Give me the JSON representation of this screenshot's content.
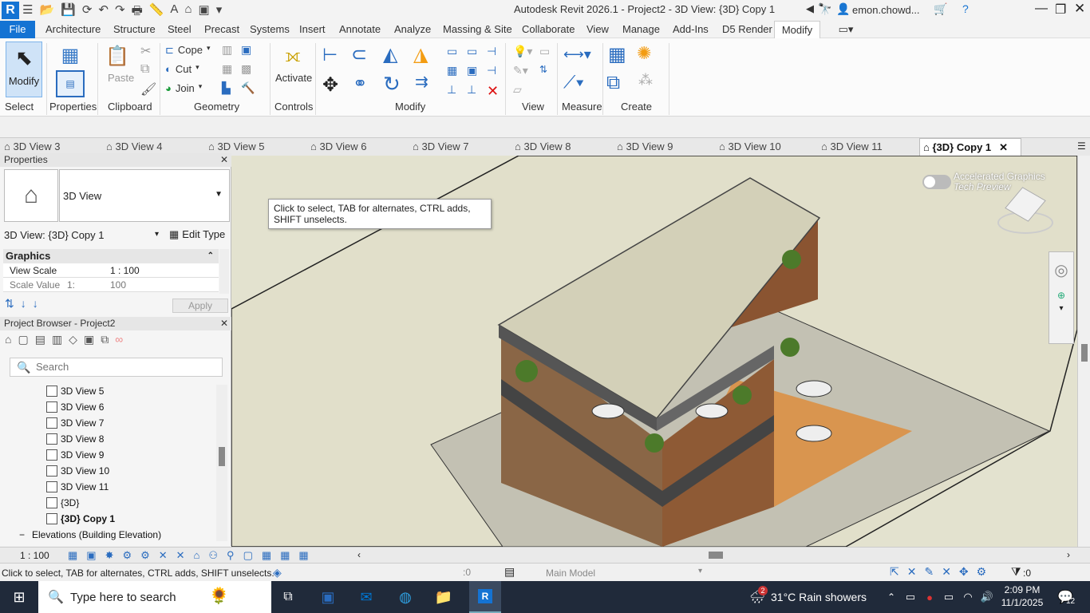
{
  "titlebar": {
    "title": "Autodesk Revit 2026.1 - Project2 - 3D View: {3D} Copy 1",
    "user": "emon.chowd..."
  },
  "ribbon_tabs": [
    "File",
    "Architecture",
    "Structure",
    "Steel",
    "Precast",
    "Systems",
    "Insert",
    "Annotate",
    "Analyze",
    "Massing & Site",
    "Collaborate",
    "View",
    "Manage",
    "Add-Ins",
    "D5 Render",
    "Modify"
  ],
  "ribbon": {
    "modify_label": "Modify",
    "select_label": "Select",
    "properties_label": "Properties",
    "clipboard_label": "Clipboard",
    "paste_label": "Paste",
    "cope_label": "Cope",
    "cut_label": "Cut",
    "join_label": "Join",
    "geometry_label": "Geometry",
    "activate_label": "Activate",
    "controls_label": "Controls",
    "modify_panel_label": "Modify",
    "view_label": "View",
    "measure_label": "Measure",
    "create_label": "Create"
  },
  "view_tabs": [
    "3D View 3",
    "3D View 4",
    "3D View 5",
    "3D View 6",
    "3D View 7",
    "3D View 8",
    "3D View 9",
    "3D View 10",
    "3D View 11",
    "{3D} Copy 1"
  ],
  "properties": {
    "title": "Properties",
    "type_name": "3D View",
    "instance_selector": "3D View: {3D} Copy 1",
    "edit_type": "Edit Type",
    "group": "Graphics",
    "rows": [
      {
        "label": "View Scale",
        "value": "1 : 100"
      },
      {
        "label": "Scale Value",
        "prefix": "1:",
        "value": "100"
      }
    ],
    "apply": "Apply"
  },
  "project_browser": {
    "title": "Project Browser - Project2",
    "search_placeholder": "Search",
    "items": [
      "3D View 5",
      "3D View 6",
      "3D View 7",
      "3D View 8",
      "3D View 9",
      "3D View 10",
      "3D View 11",
      "{3D}",
      "{3D} Copy 1"
    ],
    "elevations": "Elevations (Building Elevation)"
  },
  "tooltip": "Click to select, TAB for alternates, CTRL adds, SHIFT unselects.",
  "viewport": {
    "accel_title": "Accelerated Graphics",
    "accel_sub": "Tech Preview"
  },
  "statusbar": {
    "scale": "1 : 100",
    "message": "Click to select, TAB for alternates, CTRL adds, SHIFT unselects.",
    "zero": ":0",
    "model": "Main Model",
    "filter_count": ":0"
  },
  "taskbar": {
    "search_placeholder": "Type here to search",
    "weather": "31°C  Rain showers",
    "time": "2:09 PM",
    "date": "11/1/2025",
    "notifications": "12",
    "weather_badge": "2"
  },
  "colors": {
    "accent": "#1473d3",
    "viewport_bg": "#e3e2cf",
    "taskbar": "#202a3a"
  }
}
